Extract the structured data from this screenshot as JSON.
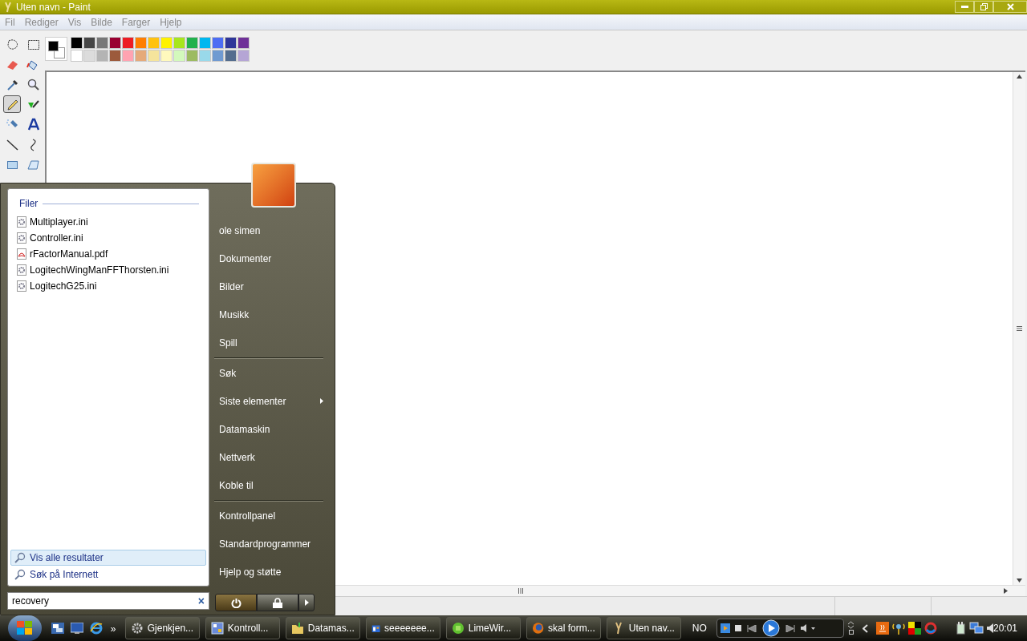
{
  "window": {
    "title": "Uten navn - Paint"
  },
  "menu": [
    "Fil",
    "Rediger",
    "Vis",
    "Bilde",
    "Farger",
    "Hjelp"
  ],
  "tools": [
    {
      "kind": "freeselect",
      "selected": false
    },
    {
      "kind": "select",
      "selected": false
    },
    {
      "kind": "eraser",
      "selected": false
    },
    {
      "kind": "fill",
      "selected": false
    },
    {
      "kind": "picker",
      "selected": false
    },
    {
      "kind": "magnifier",
      "selected": false
    },
    {
      "kind": "pencil",
      "selected": true
    },
    {
      "kind": "brush",
      "selected": false
    },
    {
      "kind": "airbrush",
      "selected": false
    },
    {
      "kind": "text",
      "selected": false
    },
    {
      "kind": "line",
      "selected": false
    },
    {
      "kind": "curve",
      "selected": false
    },
    {
      "kind": "rectangle",
      "selected": false
    },
    {
      "kind": "polygon",
      "selected": false
    }
  ],
  "palette": [
    {
      "color": "#000000"
    },
    {
      "color": "#464646"
    },
    {
      "color": "#787878"
    },
    {
      "color": "#990030"
    },
    {
      "color": "#ed1c24"
    },
    {
      "color": "#ff7e00"
    },
    {
      "color": "#ffc20e"
    },
    {
      "color": "#fff200"
    },
    {
      "color": "#a8e61d"
    },
    {
      "color": "#22b14c"
    },
    {
      "color": "#00b7ef"
    },
    {
      "color": "#4d6df3"
    },
    {
      "color": "#2f3699"
    },
    {
      "color": "#6f3198"
    },
    {
      "color": "#ffffff"
    },
    {
      "color": "#dcdcdc"
    },
    {
      "color": "#b4b4b4"
    },
    {
      "color": "#9c5a3c"
    },
    {
      "color": "#ffa3b1"
    },
    {
      "color": "#e5aa7a"
    },
    {
      "color": "#f5e49c"
    },
    {
      "color": "#fff9bd"
    },
    {
      "color": "#d3f9bc"
    },
    {
      "color": "#9dbb61"
    },
    {
      "color": "#99d9ea"
    },
    {
      "color": "#709ad1"
    },
    {
      "color": "#546d8e"
    },
    {
      "color": "#b5a5d5"
    }
  ],
  "start_menu": {
    "files_heading": "Filer",
    "files": [
      {
        "name": "Multiplayer.ini",
        "kind": "ini"
      },
      {
        "name": "Controller.ini",
        "kind": "ini"
      },
      {
        "name": "rFactorManual.pdf",
        "kind": "pdf"
      },
      {
        "name": "LogitechWingManFFThorsten.ini",
        "kind": "ini"
      },
      {
        "name": "LogitechG25.ini",
        "kind": "ini"
      }
    ],
    "actions": [
      {
        "label": "Vis alle resultater",
        "selected": true
      },
      {
        "label": "Søk på Internett",
        "selected": false
      }
    ],
    "search": {
      "value": "recovery",
      "clear": "×"
    },
    "right_groups": [
      [
        {
          "label": "ole simen",
          "submenu": false
        },
        {
          "label": "Dokumenter",
          "submenu": false
        },
        {
          "label": "Bilder",
          "submenu": false
        },
        {
          "label": "Musikk",
          "submenu": false
        },
        {
          "label": "Spill",
          "submenu": false
        }
      ],
      [
        {
          "label": "Søk",
          "submenu": false
        },
        {
          "label": "Siste elementer",
          "submenu": true
        },
        {
          "label": "Datamaskin",
          "submenu": false
        },
        {
          "label": "Nettverk",
          "submenu": false
        },
        {
          "label": "Koble til",
          "submenu": false
        }
      ],
      [
        {
          "label": "Kontrollpanel",
          "submenu": false
        },
        {
          "label": "Standardprogrammer",
          "submenu": false
        },
        {
          "label": "Hjelp og støtte",
          "submenu": false
        }
      ]
    ]
  },
  "taskbar": {
    "more": "»",
    "buttons": [
      {
        "label": "Gjenkjen..."
      },
      {
        "label": "Kontroll..."
      },
      {
        "label": "Datamas..."
      },
      {
        "label": "seeeeeee..."
      },
      {
        "label": "LimeWir..."
      },
      {
        "label": "skal form..."
      },
      {
        "label": "Uten nav..."
      }
    ],
    "language": "NO",
    "clock": "20:01"
  }
}
